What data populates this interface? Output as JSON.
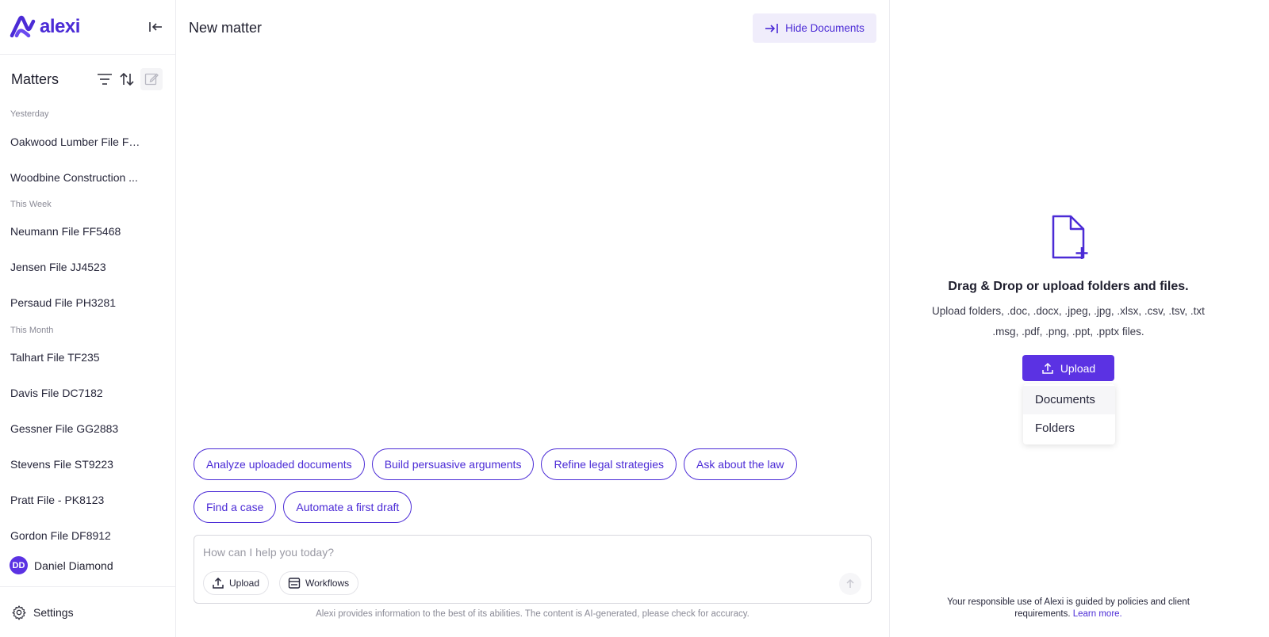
{
  "app": {
    "logo_text": "alexi",
    "accent_color": "#5b32e3"
  },
  "sidebar": {
    "matters_title": "Matters",
    "groups": [
      {
        "label": "Yesterday",
        "items": [
          "Oakwood Lumber File FT...",
          "Woodbine Construction ..."
        ]
      },
      {
        "label": "This Week",
        "items": [
          "Neumann File FF5468",
          "Jensen File JJ4523",
          "Persaud File PH3281"
        ]
      },
      {
        "label": "This Month",
        "items": [
          "Talhart File TF235",
          "Davis File DC7182",
          "Gessner File GG2883",
          "Stevens File ST9223",
          "Pratt File - PK8123",
          "Gordon File DF8912"
        ]
      }
    ],
    "user": {
      "initials": "DD",
      "name": "Daniel Diamond"
    },
    "settings_label": "Settings"
  },
  "main": {
    "title": "New matter",
    "hide_documents_label": "Hide Documents",
    "suggestions": [
      [
        "Analyze uploaded documents",
        "Build persuasive arguments",
        "Refine legal strategies",
        "Ask about the law"
      ],
      [
        "Find a case",
        "Automate a first draft"
      ]
    ],
    "composer": {
      "placeholder": "How can I help you today?",
      "upload_label": "Upload",
      "workflows_label": "Workflows"
    },
    "disclaimer": "Alexi provides information to the best of its abilities. The content is AI-generated, please check for accuracy."
  },
  "documents_panel": {
    "title": "Drag & Drop or upload folders and files.",
    "subtitle_line1": "Upload folders, .doc, .docx, .jpeg, .jpg, .xlsx, .csv, .tsv, .txt",
    "subtitle_line2": ".msg, .pdf, .png, .ppt, .pptx files.",
    "upload_label": "Upload",
    "upload_menu": [
      "Documents",
      "Folders"
    ],
    "policy_text": "Your responsible use of Alexi is guided by policies and client requirements.",
    "policy_link": "Learn more."
  }
}
